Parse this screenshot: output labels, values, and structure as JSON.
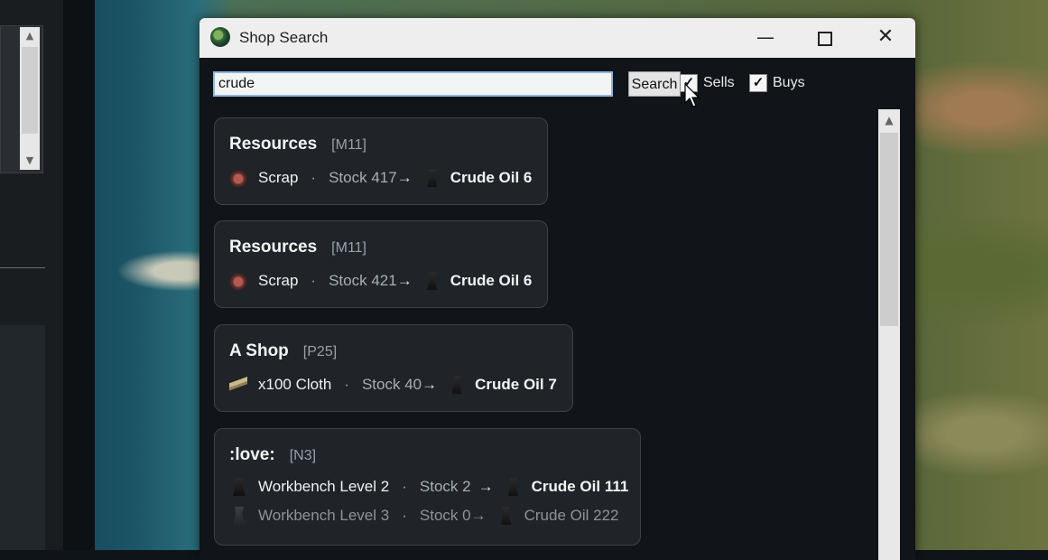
{
  "window": {
    "title": "Shop Search",
    "minimize_label": "—",
    "close_label": "✕"
  },
  "search": {
    "value": "crude",
    "button_label": "Search",
    "sells_label": "Sells",
    "sells_checked": true,
    "buys_label": "Buys",
    "buys_checked": true,
    "check_mark": "✓"
  },
  "scrollbar": {
    "up_arrow": "▲"
  },
  "results": [
    {
      "name": "Resources",
      "location": "[M11]",
      "rows": [
        {
          "icon": "scrap-icon",
          "item": "Scrap",
          "stock": "Stock 417",
          "arrow": "→",
          "cost_icon": "crude-oil-icon",
          "cost": "Crude Oil 6"
        }
      ]
    },
    {
      "name": "Resources",
      "location": "[M11]",
      "rows": [
        {
          "icon": "scrap-icon",
          "item": "Scrap",
          "stock": "Stock 421",
          "arrow": "→",
          "cost_icon": "crude-oil-icon",
          "cost": "Crude Oil 6"
        }
      ]
    },
    {
      "name": "A Shop",
      "location": "[P25]",
      "rows": [
        {
          "icon": "cloth-icon",
          "item": "x100 Cloth",
          "stock": "Stock 40",
          "arrow": "→",
          "cost_icon": "crude-oil-icon",
          "cost": "Crude Oil 7"
        }
      ]
    },
    {
      "name": ":love:",
      "location": "[N3]",
      "rows": [
        {
          "icon": "workbench-icon",
          "item": "Workbench Level 2",
          "stock": "Stock 2",
          "arrow": "→",
          "cost_icon": "crude-oil-icon",
          "cost": "Crude Oil 111"
        },
        {
          "icon": "workbench-icon",
          "item": "Workbench Level 3",
          "stock": "Stock 0",
          "arrow": "→",
          "cost_icon": "crude-oil-icon",
          "cost": "Crude Oil 222",
          "dimmed": true
        }
      ]
    }
  ],
  "colors": {
    "window_bg": "#111418",
    "card_bg": "#202428",
    "titlebar_bg": "#eeeeee",
    "input_border": "#8fb8dc"
  },
  "bullet": "·"
}
